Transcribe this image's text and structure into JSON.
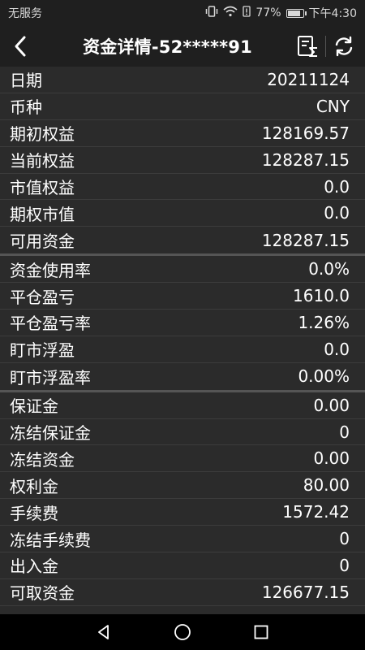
{
  "status_bar": {
    "carrier": "无服务",
    "battery_text": "77%",
    "battery_level": 0.77,
    "time": "下午4:30"
  },
  "header": {
    "title": "资金详情-52*****91"
  },
  "groups": [
    {
      "rows": [
        {
          "label": "日期",
          "value": "20211124"
        },
        {
          "label": "币种",
          "value": "CNY"
        },
        {
          "label": "期初权益",
          "value": "128169.57"
        },
        {
          "label": "当前权益",
          "value": "128287.15"
        },
        {
          "label": "市值权益",
          "value": "0.0"
        },
        {
          "label": "期权市值",
          "value": "0.0"
        },
        {
          "label": "可用资金",
          "value": "128287.15"
        }
      ]
    },
    {
      "rows": [
        {
          "label": "资金使用率",
          "value": "0.0%"
        },
        {
          "label": "平仓盈亏",
          "value": "1610.0"
        },
        {
          "label": "平仓盈亏率",
          "value": "1.26%"
        },
        {
          "label": "盯市浮盈",
          "value": "0.0"
        },
        {
          "label": "盯市浮盈率",
          "value": "0.00%"
        }
      ]
    },
    {
      "rows": [
        {
          "label": "保证金",
          "value": "0.00"
        },
        {
          "label": "冻结保证金",
          "value": "0"
        },
        {
          "label": "冻结资金",
          "value": "0.00"
        },
        {
          "label": "权利金",
          "value": "80.00"
        },
        {
          "label": "手续费",
          "value": "1572.42"
        },
        {
          "label": "冻结手续费",
          "value": "0"
        },
        {
          "label": "出入金",
          "value": "0"
        },
        {
          "label": "可取资金",
          "value": "126677.15"
        }
      ]
    }
  ]
}
